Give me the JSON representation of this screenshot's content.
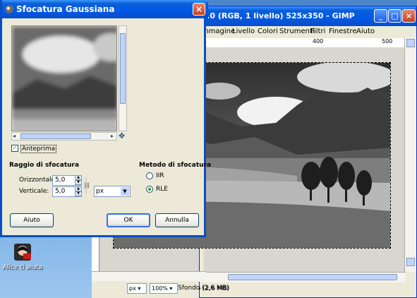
{
  "desktop": {
    "icon_label": "Alice ti aiuta"
  },
  "gimp": {
    "title": "..0 (RGB, 1 livello) 525x350 - GIMP",
    "menu": [
      "Immagine",
      "Livello",
      "Colori",
      "Strumenti",
      "Filtri",
      "Finestre",
      "Aiuto"
    ],
    "ruler_top": [
      "400",
      "500"
    ],
    "unit": "px",
    "zoom": "100%",
    "status": "Sfondo (2,6 MB)"
  },
  "dialog": {
    "title": "Sfocatura Gaussiana",
    "preview_label": "Anteprima",
    "preview_checked": true,
    "radius_section": "Raggio di sfocatura",
    "horizontal_label": "Orizzontale:",
    "horizontal_value": "5,0",
    "vertical_label": "Verticale:",
    "vertical_value": "5,0",
    "unit": "px",
    "method_section": "Metodo di sfocatura",
    "method_options": [
      "IIR",
      "RLE"
    ],
    "method_selected": "RLE",
    "btn_help": "Aiuto",
    "btn_ok": "OK",
    "btn_cancel": "Annulla"
  },
  "colors": {
    "titlebar": "#0058e6",
    "dialog_bg": "#ece9d8",
    "desktop": "#5b95d3"
  }
}
